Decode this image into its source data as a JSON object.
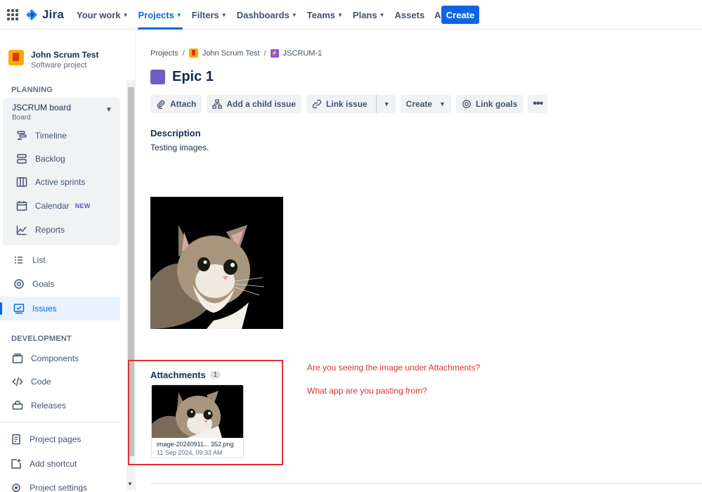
{
  "topnav": {
    "logo": "Jira",
    "items": [
      {
        "label": "Your work"
      },
      {
        "label": "Projects"
      },
      {
        "label": "Filters"
      },
      {
        "label": "Dashboards"
      },
      {
        "label": "Teams"
      },
      {
        "label": "Plans"
      },
      {
        "label": "Assets"
      },
      {
        "label": "Apps"
      }
    ],
    "create": "Create",
    "accent": "#0c66e4"
  },
  "sidebar": {
    "project_name": "John Scrum Test",
    "project_type": "Software project",
    "planning_title": "PLANNING",
    "board_title": "JSCRUM board",
    "board_sub": "Board",
    "board_items": [
      {
        "label": "Timeline",
        "icon": "timeline-icon"
      },
      {
        "label": "Backlog",
        "icon": "backlog-icon"
      },
      {
        "label": "Active sprints",
        "icon": "board-icon"
      },
      {
        "label": "Calendar",
        "icon": "calendar-icon",
        "badge": "NEW"
      },
      {
        "label": "Reports",
        "icon": "reports-icon"
      }
    ],
    "items": [
      {
        "label": "List",
        "icon": "list-icon"
      },
      {
        "label": "Goals",
        "icon": "goals-icon"
      },
      {
        "label": "Issues",
        "icon": "issues-icon"
      }
    ],
    "development_title": "DEVELOPMENT",
    "dev_items": [
      {
        "label": "Components",
        "icon": "components-icon"
      },
      {
        "label": "Code",
        "icon": "code-icon"
      },
      {
        "label": "Releases",
        "icon": "releases-icon"
      }
    ],
    "footer_items": [
      {
        "label": "Project pages",
        "icon": "page-icon"
      },
      {
        "label": "Add shortcut",
        "icon": "add-shortcut-icon"
      },
      {
        "label": "Project settings",
        "icon": "settings-icon"
      }
    ]
  },
  "issue": {
    "breadcrumb": [
      "Projects",
      "John Scrum Test",
      "JSCRUM-1"
    ],
    "title": "Epic 1",
    "toolbar": {
      "attach": "Attach",
      "add_child": "Add a child issue",
      "link_issue": "Link issue",
      "create": "Create",
      "link_goals": "Link goals"
    },
    "description_label": "Description",
    "description_text": "Testing images.",
    "attachments_label": "Attachments",
    "attachments_count": "1",
    "attachment": {
      "name": "image-20240911... 352.png",
      "date": "11 Sep 2024, 09:33 AM"
    }
  },
  "notes": {
    "q1": "Are you seeing the image under Attachments?",
    "q2": "What app are you pasting from?",
    "color": "#e03131"
  }
}
